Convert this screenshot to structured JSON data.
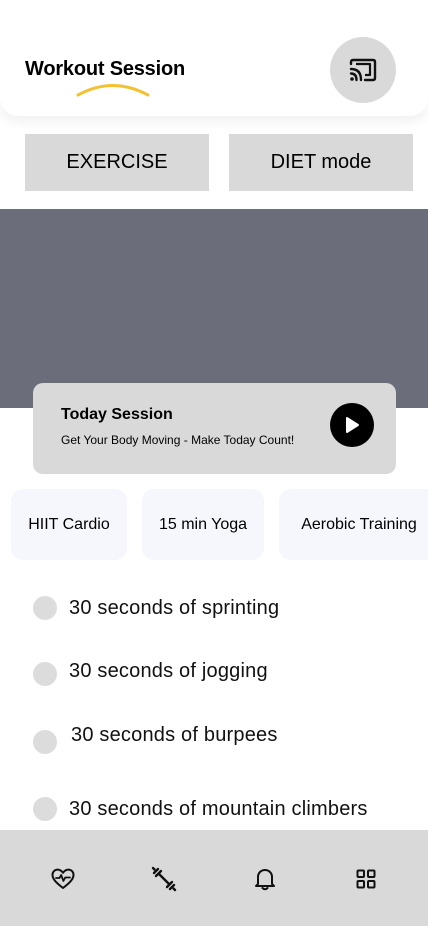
{
  "header": {
    "title": "Workout Session",
    "cast_icon": "cast-icon",
    "accent_color": "#f2c230"
  },
  "modes": {
    "exercise_label": "EXERCISE",
    "diet_label": "DIET mode"
  },
  "session": {
    "title": "Today Session",
    "subtitle": "Get Your Body Moving - Make Today Count!",
    "play_icon": "play-icon"
  },
  "categories": [
    {
      "label": "HIIT Cardio"
    },
    {
      "label": "15 min Yoga"
    },
    {
      "label": "Aerobic Training"
    }
  ],
  "exercises": [
    {
      "label": "30 seconds of sprinting"
    },
    {
      "label": "30 seconds of jogging"
    },
    {
      "label": "30 seconds of burpees"
    },
    {
      "label": "30 seconds of mountain climbers"
    }
  ],
  "bottom_nav": {
    "items": [
      {
        "icon": "heart-pulse-icon"
      },
      {
        "icon": "dumbbell-icon"
      },
      {
        "icon": "bell-icon"
      },
      {
        "icon": "grid-icon"
      }
    ]
  }
}
